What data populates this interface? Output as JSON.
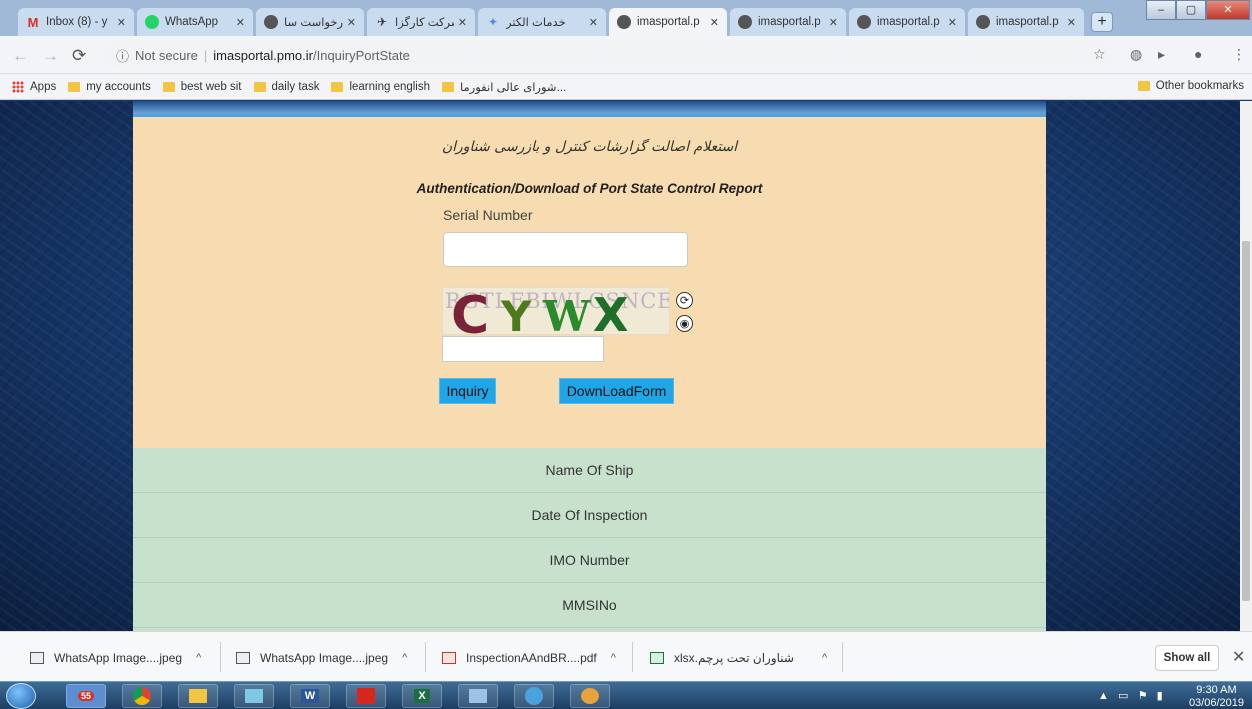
{
  "browser": {
    "tabs": [
      {
        "title": "Inbox (8) - y",
        "fav": "M",
        "color": "#d93025"
      },
      {
        "title": "WhatsApp",
        "fav": "W",
        "color": "#25d366"
      },
      {
        "title": "درخواست سا",
        "fav": "•",
        "color": "#555"
      },
      {
        "title": "شرکت کارگزا",
        "fav": "✈",
        "color": "#333"
      },
      {
        "title": "خدمات الکتر",
        "fav": "✦",
        "color": "#5b8dd6"
      },
      {
        "title": "imasportal.p",
        "fav": "•",
        "color": "#555"
      },
      {
        "title": "imasportal.p",
        "fav": "•",
        "color": "#555"
      },
      {
        "title": "imasportal.p",
        "fav": "•",
        "color": "#555"
      },
      {
        "title": "imasportal.p",
        "fav": "•",
        "color": "#555"
      }
    ],
    "new_tab_label": "+",
    "window_buttons": {
      "minimize": "–",
      "maximize": "▢",
      "close": "✕"
    },
    "address": {
      "security_label": "Not secure",
      "host": "imasportal.pmo.ir",
      "path": "/InquiryPortState"
    },
    "bookmarks": [
      {
        "label": "Apps"
      },
      {
        "label": "my accounts"
      },
      {
        "label": "best web sit"
      },
      {
        "label": "daily task"
      },
      {
        "label": "learning english"
      },
      {
        "label": "شورای عالی انفورما..."
      }
    ],
    "other_bookmarks": "Other bookmarks"
  },
  "page": {
    "title_fa": "استعلام اصالت گزارشات کنترل و بازرسی شناوران",
    "title_en": "Authentication/Download of Port State Control Report",
    "serial_label": "Serial Number",
    "serial_value": "",
    "captcha": {
      "text_chars": [
        "C",
        "Y",
        "W",
        "X"
      ],
      "noise_text": "RGTLFBIWLCSNCE",
      "refresh_icon": "refresh-icon",
      "audio_icon": "audio-icon"
    },
    "captcha_input_value": "",
    "buttons": {
      "inquiry": "Inquiry",
      "download": "DownLoadForm"
    },
    "result_rows": [
      "Name Of Ship",
      "Date Of Inspection",
      "IMO Number",
      "MMSINo"
    ],
    "colors": {
      "form_bg": "#f6dcb0",
      "results_bg": "#c7e1cd",
      "button_bg": "#1ea6e6"
    }
  },
  "downloads": {
    "items": [
      {
        "name": "WhatsApp Image....jpeg",
        "type": "image"
      },
      {
        "name": "WhatsApp Image....jpeg",
        "type": "image"
      },
      {
        "name": "InspectionAAndBR....pdf",
        "type": "pdf"
      },
      {
        "name": "شناوران تحت پرچم.xlsx",
        "type": "xlsx"
      }
    ],
    "show_all": "Show all"
  },
  "taskbar": {
    "apps": [
      "55",
      "",
      "",
      "",
      "W",
      "",
      "X",
      "",
      "",
      ""
    ],
    "clock_time": "9:30 AM",
    "clock_date": "03/06/2019"
  }
}
